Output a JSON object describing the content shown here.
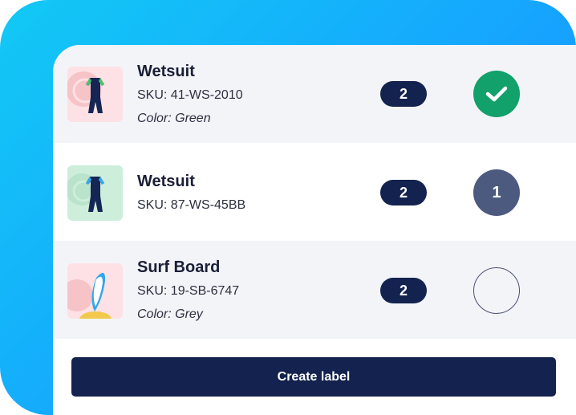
{
  "items": [
    {
      "name": "Wetsuit",
      "sku": "SKU: 41-WS-2010",
      "color": "Color: Green",
      "qty": "2",
      "status": "done",
      "thumb_bg": "#fde1e4",
      "thumb_icon": "wetsuit-icon"
    },
    {
      "name": "Wetsuit",
      "sku": "SKU: 87-WS-45BB",
      "color": "",
      "qty": "2",
      "status": "1",
      "thumb_bg": "#cdeedb",
      "thumb_icon": "wetsuit-icon"
    },
    {
      "name": "Surf Board",
      "sku": "SKU: 19-SB-6747",
      "color": "Color: Grey",
      "qty": "2",
      "status": "",
      "thumb_bg": "#fde1e4",
      "thumb_icon": "surfboard-icon"
    }
  ],
  "actions": {
    "create_label": "Create label"
  },
  "colors": {
    "accent_navy": "#13224e",
    "success_green": "#12a06b",
    "frame_blue": "#16a2ff"
  }
}
